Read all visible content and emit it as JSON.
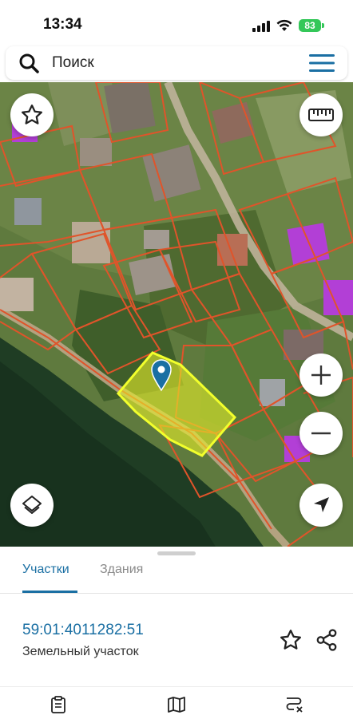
{
  "status": {
    "time": "13:34",
    "battery": "83"
  },
  "search": {
    "placeholder": "Поиск"
  },
  "tabs": [
    {
      "label": "Участки",
      "active": true
    },
    {
      "label": "Здания",
      "active": false
    }
  ],
  "parcel": {
    "cadastral_number": "59:01:4011282:51",
    "type": "Земельный участок"
  },
  "icons": {
    "search": "search-icon",
    "menu": "menu-icon",
    "favorite_map": "star-icon",
    "ruler": "ruler-icon",
    "zoom_in": "plus-icon",
    "zoom_out": "minus-icon",
    "layers": "layers-icon",
    "locate": "location-arrow-icon",
    "pin": "map-pin-icon",
    "favorite": "star-outline-icon",
    "share": "share-icon",
    "nav_list": "clipboard-icon",
    "nav_map": "map-icon",
    "nav_routes": "route-icon"
  },
  "colors": {
    "accent": "#1a6fa3",
    "parcel_boundary": "#e0542a",
    "selected_fill": "#e6ee2a",
    "building_highlight": "#b23fd6",
    "battery": "#34c759"
  }
}
